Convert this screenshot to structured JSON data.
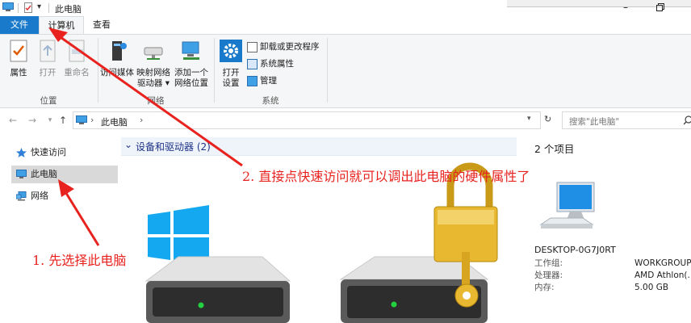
{
  "window": {
    "title": "此电脑"
  },
  "tabs": [
    {
      "label": "文件"
    },
    {
      "label": "计算机"
    },
    {
      "label": "查看"
    }
  ],
  "ribbon": {
    "location": {
      "label": "位置",
      "buttons": [
        "属性",
        "打开",
        "重命名"
      ]
    },
    "network": {
      "label": "网络",
      "buttons": [
        [
          "访问媒体",
          ""
        ],
        [
          "映射网络",
          "驱动器 ▾"
        ],
        [
          "添加一个",
          "网络位置"
        ]
      ]
    },
    "system": {
      "label": "系统",
      "open_settings": [
        "打开",
        "设置"
      ],
      "items": [
        "卸载或更改程序",
        "系统属性",
        "管理"
      ]
    }
  },
  "address": {
    "path": "此电脑",
    "search_placeholder": "搜索\"此电脑\""
  },
  "nav": [
    {
      "label": "快速访问"
    },
    {
      "label": "此电脑"
    },
    {
      "label": "网络"
    }
  ],
  "content": {
    "group_header": "设备和驱动器 (2)"
  },
  "details": {
    "count": "2 个项目",
    "computer_name": "DESKTOP-0G7J0RT",
    "rows": [
      {
        "k": "工作组:",
        "v": "WORKGROUP"
      },
      {
        "k": "处理器:",
        "v": "AMD Athlon(..."
      },
      {
        "k": "内存:",
        "v": "5.00 GB"
      }
    ]
  },
  "annotations": {
    "step1": "1. 先选择此电脑",
    "step2": "2. 直接点快速访问就可以调出此电脑的硬件属性了"
  },
  "colors": {
    "accent": "#1979ca",
    "annotation": "#e8231f",
    "header_text": "#1e3287"
  }
}
